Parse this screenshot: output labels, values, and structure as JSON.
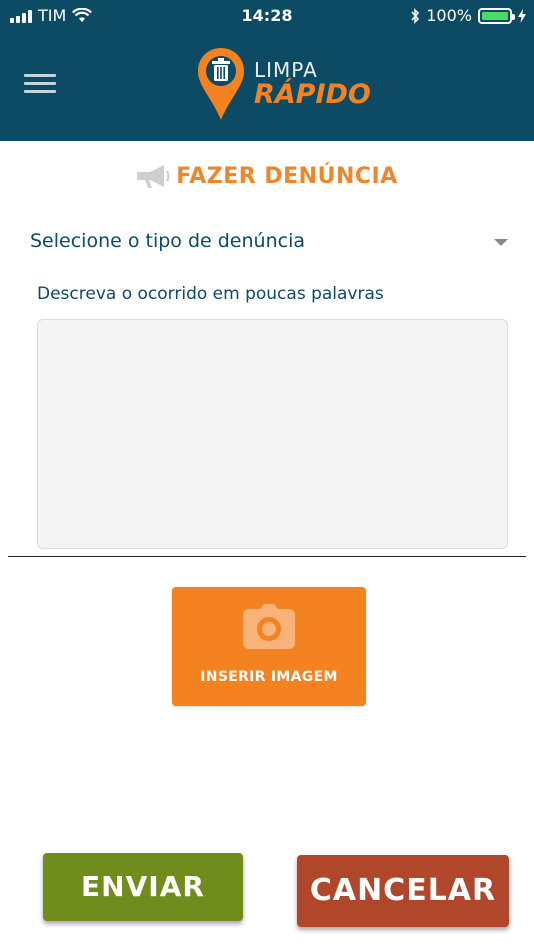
{
  "status_bar": {
    "carrier": "TIM",
    "time": "14:28",
    "battery_percent": "100%",
    "battery_level": 1.0,
    "icons": [
      "signal-icon",
      "wifi-icon",
      "bluetooth-icon",
      "battery-icon",
      "charging-icon"
    ]
  },
  "header": {
    "menu_icon": "hamburger-icon",
    "logo_line1": "LIMPA",
    "logo_line2": "RÁPIDO",
    "logo_icon": "trash-pin-icon",
    "background_color": "#0d4a63",
    "accent_color": "#f58220"
  },
  "form": {
    "title": "FAZER DENÚNCIA",
    "title_icon": "megaphone-icon",
    "title_color": "#f0862a",
    "select_label": "Selecione o tipo de denúncia",
    "description_label": "Descreva o ocorrido em poucas palavras",
    "description_value": "",
    "image_button_label": "INSERIR IMAGEM",
    "image_button_icon": "camera-icon"
  },
  "actions": {
    "send_label": "ENVIAR",
    "send_color": "#6f8c1d",
    "cancel_label": "CANCELAR",
    "cancel_color": "#b0472b"
  }
}
